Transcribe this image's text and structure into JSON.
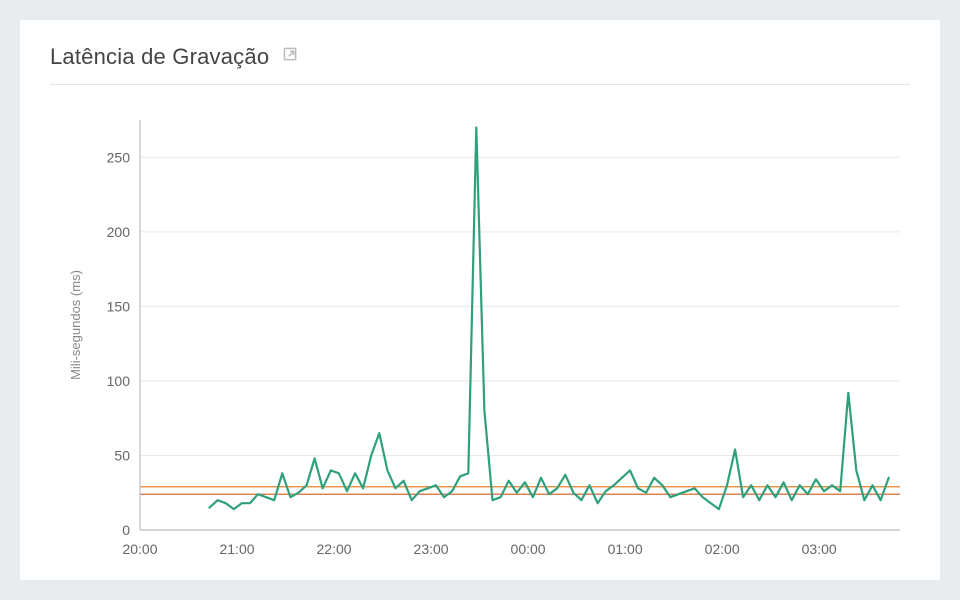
{
  "card": {
    "title": "Latência de Gravação",
    "external_icon": "external-link"
  },
  "chart_data": {
    "type": "line",
    "title": "Latência de Gravação",
    "xlabel": "",
    "ylabel": "Mili-segundos (ms)",
    "x_ticks": [
      "20:00",
      "21:00",
      "22:00",
      "23:00",
      "00:00",
      "01:00",
      "02:00",
      "03:00"
    ],
    "y_ticks": [
      0,
      50,
      100,
      150,
      200,
      250
    ],
    "ylim": [
      0,
      275
    ],
    "xlim_minutes": [
      0,
      470
    ],
    "thresholds": [
      {
        "name": "threshold-a",
        "value": 29,
        "color": "#e7812d"
      },
      {
        "name": "threshold-b",
        "value": 24,
        "color": "#d46b3a"
      }
    ],
    "series": [
      {
        "name": "write-latency",
        "color": "#2fa07c",
        "points": [
          {
            "x_min": 43,
            "y": 15
          },
          {
            "x_min": 48,
            "y": 20
          },
          {
            "x_min": 53,
            "y": 18
          },
          {
            "x_min": 58,
            "y": 14
          },
          {
            "x_min": 63,
            "y": 18
          },
          {
            "x_min": 68,
            "y": 18
          },
          {
            "x_min": 73,
            "y": 24
          },
          {
            "x_min": 78,
            "y": 22
          },
          {
            "x_min": 83,
            "y": 20
          },
          {
            "x_min": 88,
            "y": 38
          },
          {
            "x_min": 93,
            "y": 22
          },
          {
            "x_min": 98,
            "y": 25
          },
          {
            "x_min": 103,
            "y": 30
          },
          {
            "x_min": 108,
            "y": 48
          },
          {
            "x_min": 113,
            "y": 28
          },
          {
            "x_min": 118,
            "y": 40
          },
          {
            "x_min": 123,
            "y": 38
          },
          {
            "x_min": 128,
            "y": 26
          },
          {
            "x_min": 133,
            "y": 38
          },
          {
            "x_min": 138,
            "y": 28
          },
          {
            "x_min": 143,
            "y": 50
          },
          {
            "x_min": 148,
            "y": 65
          },
          {
            "x_min": 153,
            "y": 40
          },
          {
            "x_min": 158,
            "y": 28
          },
          {
            "x_min": 163,
            "y": 33
          },
          {
            "x_min": 168,
            "y": 20
          },
          {
            "x_min": 173,
            "y": 26
          },
          {
            "x_min": 178,
            "y": 28
          },
          {
            "x_min": 183,
            "y": 30
          },
          {
            "x_min": 188,
            "y": 22
          },
          {
            "x_min": 193,
            "y": 26
          },
          {
            "x_min": 198,
            "y": 36
          },
          {
            "x_min": 203,
            "y": 38
          },
          {
            "x_min": 208,
            "y": 270
          },
          {
            "x_min": 213,
            "y": 80
          },
          {
            "x_min": 218,
            "y": 20
          },
          {
            "x_min": 223,
            "y": 22
          },
          {
            "x_min": 228,
            "y": 33
          },
          {
            "x_min": 233,
            "y": 25
          },
          {
            "x_min": 238,
            "y": 32
          },
          {
            "x_min": 243,
            "y": 22
          },
          {
            "x_min": 248,
            "y": 35
          },
          {
            "x_min": 253,
            "y": 24
          },
          {
            "x_min": 258,
            "y": 28
          },
          {
            "x_min": 263,
            "y": 37
          },
          {
            "x_min": 268,
            "y": 25
          },
          {
            "x_min": 273,
            "y": 20
          },
          {
            "x_min": 278,
            "y": 30
          },
          {
            "x_min": 283,
            "y": 18
          },
          {
            "x_min": 288,
            "y": 26
          },
          {
            "x_min": 293,
            "y": 30
          },
          {
            "x_min": 298,
            "y": 35
          },
          {
            "x_min": 303,
            "y": 40
          },
          {
            "x_min": 308,
            "y": 28
          },
          {
            "x_min": 313,
            "y": 25
          },
          {
            "x_min": 318,
            "y": 35
          },
          {
            "x_min": 323,
            "y": 30
          },
          {
            "x_min": 328,
            "y": 22
          },
          {
            "x_min": 333,
            "y": 24
          },
          {
            "x_min": 338,
            "y": 26
          },
          {
            "x_min": 343,
            "y": 28
          },
          {
            "x_min": 348,
            "y": 22
          },
          {
            "x_min": 353,
            "y": 18
          },
          {
            "x_min": 358,
            "y": 14
          },
          {
            "x_min": 363,
            "y": 30
          },
          {
            "x_min": 368,
            "y": 54
          },
          {
            "x_min": 373,
            "y": 22
          },
          {
            "x_min": 378,
            "y": 30
          },
          {
            "x_min": 383,
            "y": 20
          },
          {
            "x_min": 388,
            "y": 30
          },
          {
            "x_min": 393,
            "y": 22
          },
          {
            "x_min": 398,
            "y": 32
          },
          {
            "x_min": 403,
            "y": 20
          },
          {
            "x_min": 408,
            "y": 30
          },
          {
            "x_min": 413,
            "y": 24
          },
          {
            "x_min": 418,
            "y": 34
          },
          {
            "x_min": 423,
            "y": 26
          },
          {
            "x_min": 428,
            "y": 30
          },
          {
            "x_min": 433,
            "y": 26
          },
          {
            "x_min": 438,
            "y": 92
          },
          {
            "x_min": 443,
            "y": 40
          },
          {
            "x_min": 448,
            "y": 20
          },
          {
            "x_min": 453,
            "y": 30
          },
          {
            "x_min": 458,
            "y": 20
          },
          {
            "x_min": 463,
            "y": 35
          }
        ]
      }
    ]
  }
}
